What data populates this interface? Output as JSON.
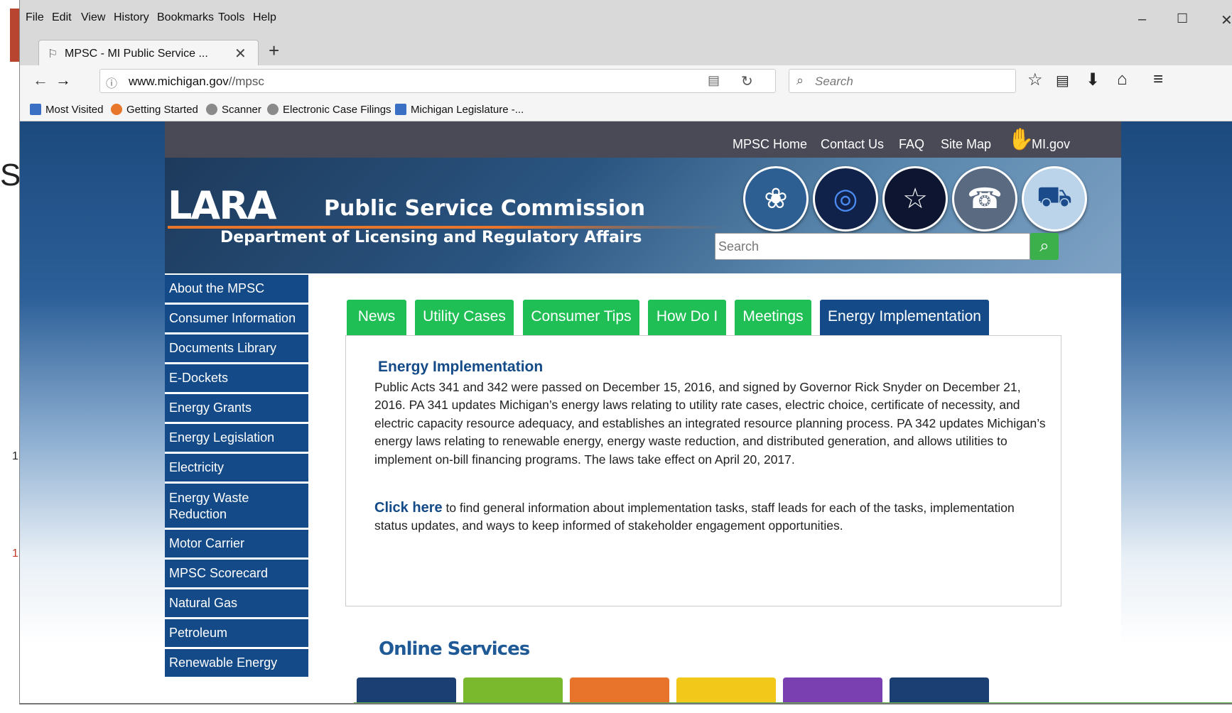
{
  "background_doc": {
    "chars": [
      "S",
      "1",
      "1"
    ]
  },
  "menubar": {
    "items": [
      "File",
      "Edit",
      "View",
      "History",
      "Bookmarks",
      "Tools",
      "Help"
    ],
    "window_controls": [
      "–",
      "☐",
      "✕"
    ]
  },
  "tab": {
    "title": "MPSC - MI Public Service ...",
    "close": "✕",
    "new_tab": "+"
  },
  "navbar": {
    "url_host": "www.michigan.gov",
    "url_path": "//mpsc",
    "search_placeholder": "Search"
  },
  "bookmarks": [
    {
      "label": "Most Visited",
      "color": "#3a6fc4"
    },
    {
      "label": "Getting Started",
      "color": "#e8762b"
    },
    {
      "label": "Scanner",
      "color": "#8a8a8a"
    },
    {
      "label": "Electronic Case Filings",
      "color": "#8a8a8a"
    },
    {
      "label": "Michigan Legislature -...",
      "color": "#3a6fc4"
    }
  ],
  "site": {
    "top_nav": [
      "MPSC Home",
      "Contact Us",
      "FAQ",
      "Site Map",
      "MI.gov"
    ],
    "logo": "LARA",
    "commission": "Public Service Commission",
    "department": "Department of Licensing and Regulatory Affairs",
    "search_placeholder": "Search",
    "side_nav": [
      "About the MPSC",
      "Consumer Information",
      "Documents Library",
      "E-Dockets",
      "Energy Grants",
      "Energy Legislation",
      "Electricity",
      "Energy Waste Reduction",
      "Motor Carrier",
      "MPSC Scorecard",
      "Natural Gas",
      "Petroleum",
      "Renewable Energy"
    ],
    "content_tabs": [
      "News",
      "Utility Cases",
      "Consumer Tips",
      "How Do I",
      "Meetings",
      "Energy Implementation"
    ],
    "active_tab": "Energy Implementation",
    "panel": {
      "title": "Energy Implementation",
      "body": "Public Acts 341 and 342 were passed on December 15, 2016, and signed by Governor Rick Snyder on December 21, 2016. PA 341 updates Michigan’s energy laws relating to utility rate cases, electric choice, certificate of necessity, and electric capacity resource adequacy, and establishes an integrated resource planning process. PA 342 updates Michigan’s energy laws relating to renewable energy, energy waste reduction, and distributed generation, and allows utilities to implement on-bill financing programs. The laws take effect on April 20, 2017.",
      "click_link": "Click here",
      "click_text": " to find general information about implementation tasks, staff leads for each of the tasks, implementation status updates, and ways to keep informed of stakeholder engagement opportunities."
    },
    "online_services": "Online Services",
    "service_colors": [
      "#1b3f73",
      "#7ab82e",
      "#e8742b",
      "#f2c81a",
      "#7a3fb0",
      "#1b3f73"
    ]
  }
}
